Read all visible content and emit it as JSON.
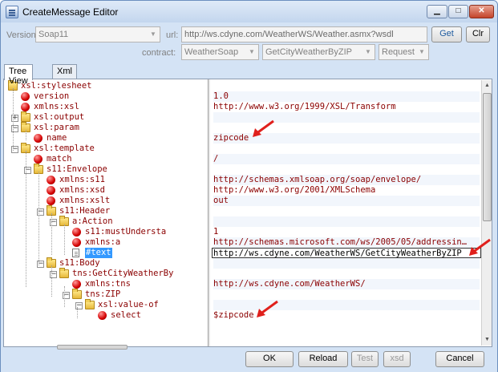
{
  "window": {
    "title": "CreateMessage Editor"
  },
  "form": {
    "version_label": "Version:",
    "version_value": "Soap11",
    "url_label": "url:",
    "url_value": "http://ws.cdyne.com/WeatherWS/Weather.asmx?wsdl",
    "get_label": "Get",
    "clr_label": "Clr",
    "contract_label": "contract:",
    "contract_value": "WeatherSoap",
    "operation_value": "GetCityWeatherByZIP",
    "message_value": "Request"
  },
  "tabs": [
    {
      "label": "Tree View",
      "active": true
    },
    {
      "label": "Xml",
      "active": false
    }
  ],
  "tree": [
    {
      "label": "xsl:stylesheet",
      "icon": "folder-icon",
      "level": 0,
      "expander": "",
      "value": ""
    },
    {
      "label": "version",
      "icon": "attribute-icon",
      "level": 1,
      "expander": "",
      "value": "1.0"
    },
    {
      "label": "xmlns:xsl",
      "icon": "attribute-icon",
      "level": 1,
      "expander": "",
      "value": "http://www.w3.org/1999/XSL/Transform"
    },
    {
      "label": "xsl:output",
      "icon": "folder-icon",
      "level": 1,
      "expander": "+",
      "value": ""
    },
    {
      "label": "xsl:param",
      "icon": "folder-icon",
      "level": 1,
      "expander": "−",
      "value": ""
    },
    {
      "label": "name",
      "icon": "attribute-icon",
      "level": 2,
      "expander": "",
      "value": "zipcode"
    },
    {
      "label": "xsl:template",
      "icon": "folder-icon",
      "level": 1,
      "expander": "−",
      "value": ""
    },
    {
      "label": "match",
      "icon": "attribute-icon",
      "level": 2,
      "expander": "",
      "value": "/"
    },
    {
      "label": "s11:Envelope",
      "icon": "folder-icon",
      "level": 2,
      "expander": "−",
      "value": ""
    },
    {
      "label": "xmlns:s11",
      "icon": "attribute-icon",
      "level": 3,
      "expander": "",
      "value": "http://schemas.xmlsoap.org/soap/envelope/"
    },
    {
      "label": "xmlns:xsd",
      "icon": "attribute-icon",
      "level": 3,
      "expander": "",
      "value": "http://www.w3.org/2001/XMLSchema"
    },
    {
      "label": "xmlns:xslt",
      "icon": "attribute-icon",
      "level": 3,
      "expander": "",
      "value": "out"
    },
    {
      "label": "s11:Header",
      "icon": "folder-icon",
      "level": 3,
      "expander": "−",
      "value": ""
    },
    {
      "label": "a:Action",
      "icon": "folder-icon",
      "level": 4,
      "expander": "−",
      "value": ""
    },
    {
      "label": "s11:mustUndersta",
      "icon": "attribute-icon",
      "level": 5,
      "expander": "",
      "value": "1"
    },
    {
      "label": "xmlns:a",
      "icon": "attribute-icon",
      "level": 5,
      "expander": "",
      "value": "http://schemas.microsoft.com/ws/2005/05/addressin…"
    },
    {
      "label": "#text",
      "icon": "text-node-icon",
      "level": 5,
      "expander": "",
      "value": "http://ws.cdyne.com/WeatherWS/GetCityWeatherByZIP",
      "selected": true
    },
    {
      "label": "s11:Body",
      "icon": "folder-icon",
      "level": 3,
      "expander": "−",
      "value": ""
    },
    {
      "label": "tns:GetCityWeatherBy",
      "icon": "folder-icon",
      "level": 4,
      "expander": "−",
      "value": ""
    },
    {
      "label": "xmlns:tns",
      "icon": "attribute-icon",
      "level": 5,
      "expander": "",
      "value": "http://ws.cdyne.com/WeatherWS/"
    },
    {
      "label": "tns:ZIP",
      "icon": "folder-icon",
      "level": 5,
      "expander": "−",
      "value": ""
    },
    {
      "label": "xsl:value-of",
      "icon": "folder-icon",
      "level": 6,
      "expander": "−",
      "value": ""
    },
    {
      "label": "select",
      "icon": "attribute-icon",
      "level": 7,
      "expander": "",
      "value": "$zipcode"
    }
  ],
  "buttons": {
    "ok": "OK",
    "reload": "Reload",
    "test": "Test",
    "xsd": "xsd",
    "cancel": "Cancel"
  },
  "colors": {
    "node_text": "#8b0000",
    "selection": "#3399ff",
    "annotation_arrow": "#e0201c"
  }
}
